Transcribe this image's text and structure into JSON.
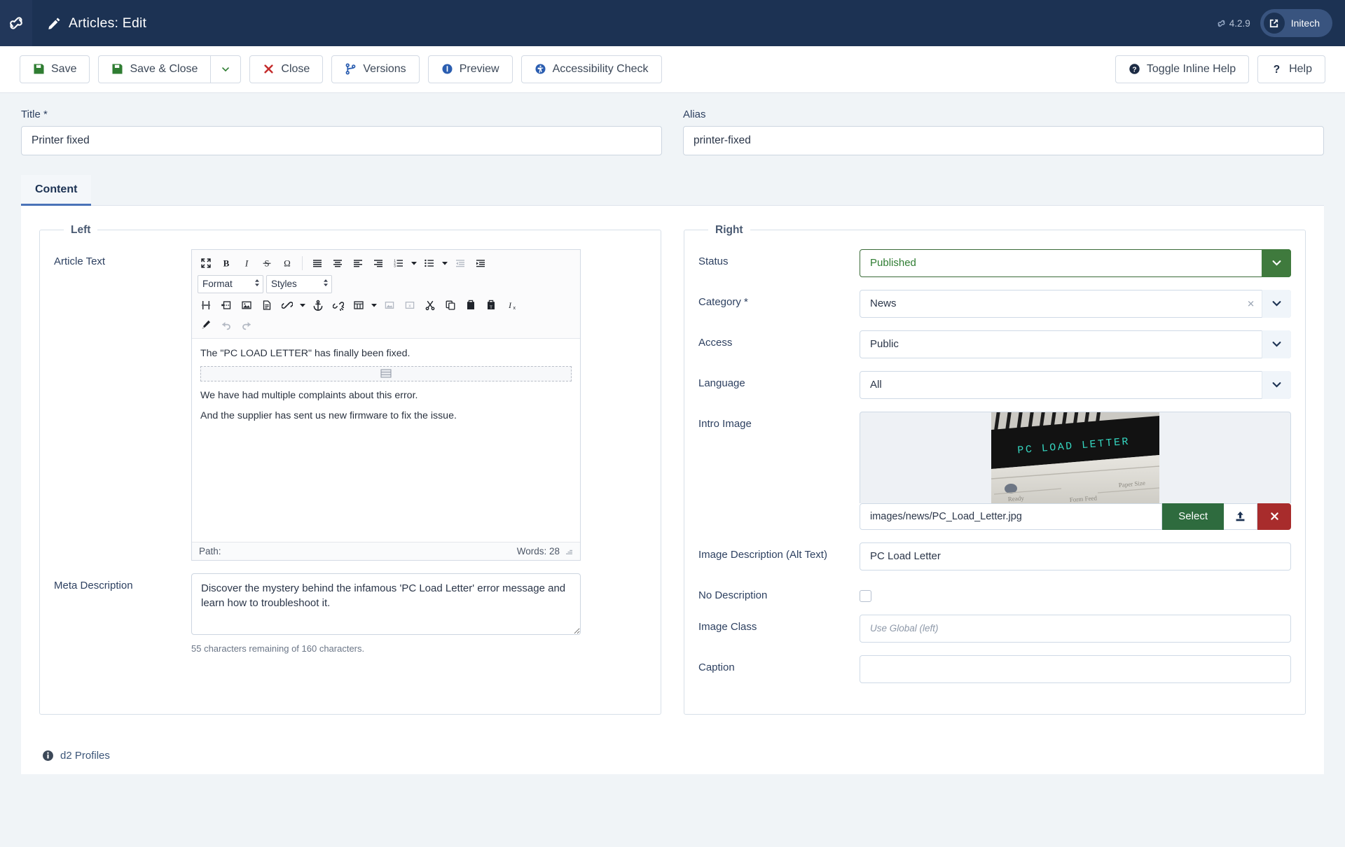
{
  "header": {
    "title": "Articles: Edit",
    "logo_icon": "joomla-logo-icon",
    "pencil_icon": "pencil-icon",
    "version": "4.2.9",
    "version_icon": "joomla-mark-icon",
    "user_name": "Initech",
    "user_icon": "external-link-icon"
  },
  "toolbar": {
    "save": "Save",
    "save_close": "Save & Close",
    "save_dropdown_icon": "chevron-down-icon",
    "close": "Close",
    "versions": "Versions",
    "preview": "Preview",
    "accessibility": "Accessibility Check",
    "toggle_inline_help": "Toggle Inline Help",
    "help": "Help"
  },
  "fields": {
    "title_label": "Title *",
    "title_value": "Printer fixed",
    "alias_label": "Alias",
    "alias_value": "printer-fixed"
  },
  "tabs": [
    {
      "label": "Content",
      "active": true
    }
  ],
  "left": {
    "legend": "Left",
    "article_text_label": "Article Text",
    "editor": {
      "format_select": "Format",
      "styles_select": "Styles",
      "row1_icons": [
        "fullscreen-icon",
        "bold-icon",
        "italic-icon",
        "strikethrough-icon",
        "special-character-icon",
        "align-justify-icon",
        "align-center-icon",
        "align-left-icon",
        "align-right-icon",
        "numbered-list-icon",
        "bulleted-list-icon",
        "outdent-icon",
        "indent-icon"
      ],
      "row3_icons": [
        "page-break-icon",
        "read-more-icon",
        "insert-image-icon",
        "insert-document-icon",
        "insert-link-icon",
        "anchor-icon",
        "unlink-icon",
        "table-icon",
        "insert-module-icon",
        "insert-field-icon",
        "cut-icon",
        "copy-icon",
        "paste-icon",
        "paste-as-text-icon",
        "clear-formatting-icon"
      ],
      "row4_icons": [
        "source-code-icon",
        "undo-icon",
        "redo-icon"
      ],
      "content_paragraphs": [
        "The \"PC LOAD LETTER\" has finally been fixed.",
        "We have had multiple complaints about this error.",
        "And the supplier has sent us new firmware to fix the issue."
      ],
      "readmore_divider_icon": "read-more-divider-icon",
      "path_label": "Path:",
      "word_count": "Words: 28",
      "resize_icon": "resize-grip-icon"
    },
    "meta_description_label": "Meta Description",
    "meta_description_value": "Discover the mystery behind the infamous 'PC Load Letter' error message and learn how to troubleshoot it.",
    "meta_description_note": "55 characters remaining of 160 characters."
  },
  "right": {
    "legend": "Right",
    "status_label": "Status",
    "status_value": "Published",
    "status_color": "#2f7d32",
    "status_arrow_bg": "#3f7a3d",
    "category_label": "Category *",
    "category_value": "News",
    "category_clear_icon": "clear-x-icon",
    "access_label": "Access",
    "access_value": "Public",
    "language_label": "Language",
    "language_value": "All",
    "intro_image_label": "Intro Image",
    "intro_image_alt": "PC Load Letter",
    "intro_image_display_text": "PC LOAD LETTER",
    "intro_image_panel_labels": [
      "Ready",
      "Form Feed",
      "Paper Size"
    ],
    "media_path_value": "images/news/PC_Load_Letter.jpg",
    "media_select_label": "Select",
    "media_upload_icon": "upload-icon",
    "media_clear_icon": "close-x-icon",
    "alt_text_label": "Image Description (Alt Text)",
    "alt_text_value": "PC Load Letter",
    "no_description_label": "No Description",
    "no_description_checked": false,
    "image_class_label": "Image Class",
    "image_class_placeholder": "Use Global (left)",
    "caption_label": "Caption",
    "caption_value": ""
  },
  "footer": {
    "info_icon": "info-circle-icon",
    "text": "d2 Profiles"
  }
}
